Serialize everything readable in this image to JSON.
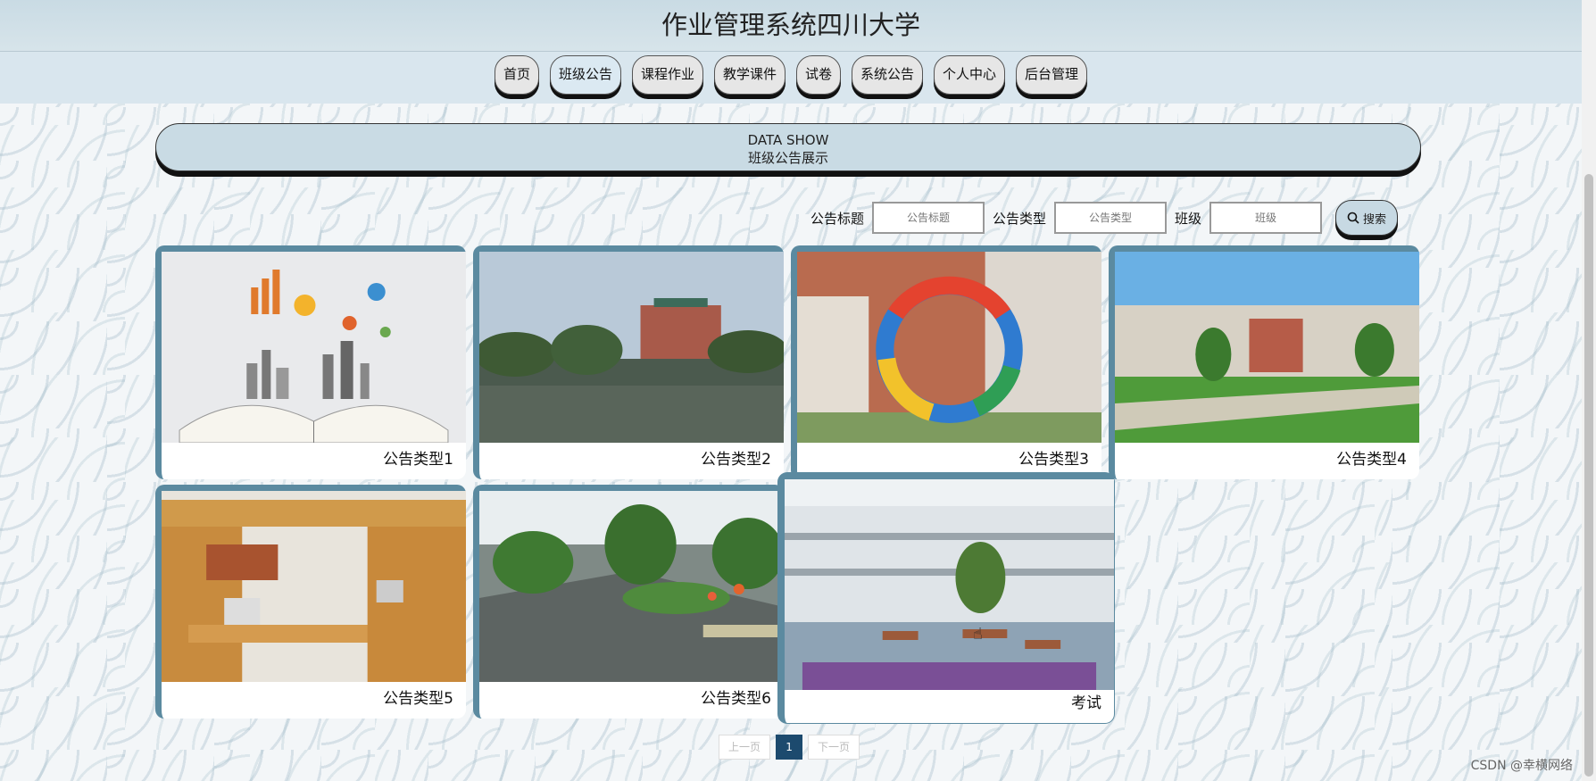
{
  "header": {
    "title": "作业管理系统四川大学"
  },
  "nav": {
    "items": [
      "首页",
      "班级公告",
      "课程作业",
      "教学课件",
      "试卷",
      "系统公告",
      "个人中心",
      "后台管理"
    ],
    "active_index": 1
  },
  "banner": {
    "line1": "DATA SHOW",
    "line2": "班级公告展示"
  },
  "search": {
    "title_label": "公告标题",
    "title_placeholder": "公告标题",
    "type_label": "公告类型",
    "type_placeholder": "公告类型",
    "class_label": "班级",
    "class_placeholder": "班级",
    "button_label": "搜索"
  },
  "cards": [
    {
      "caption": "公告类型1",
      "image": "book-infographic"
    },
    {
      "caption": "公告类型2",
      "image": "campus-lake"
    },
    {
      "caption": "公告类型3",
      "image": "ring-sculpture"
    },
    {
      "caption": "公告类型4",
      "image": "curved-building-lawn"
    },
    {
      "caption": "公告类型5",
      "image": "dorm-room"
    },
    {
      "caption": "公告类型6",
      "image": "garden-steps"
    },
    {
      "caption": "考试",
      "image": "school-courtyard"
    }
  ],
  "pager": {
    "prev": "上一页",
    "current": "1",
    "next": "下一页"
  },
  "watermark": "CSDN @幸横网络",
  "colors": {
    "accent": "#5b8aa0",
    "pager_active": "#1c4a6e",
    "header_bg": "#c9dbe4"
  }
}
